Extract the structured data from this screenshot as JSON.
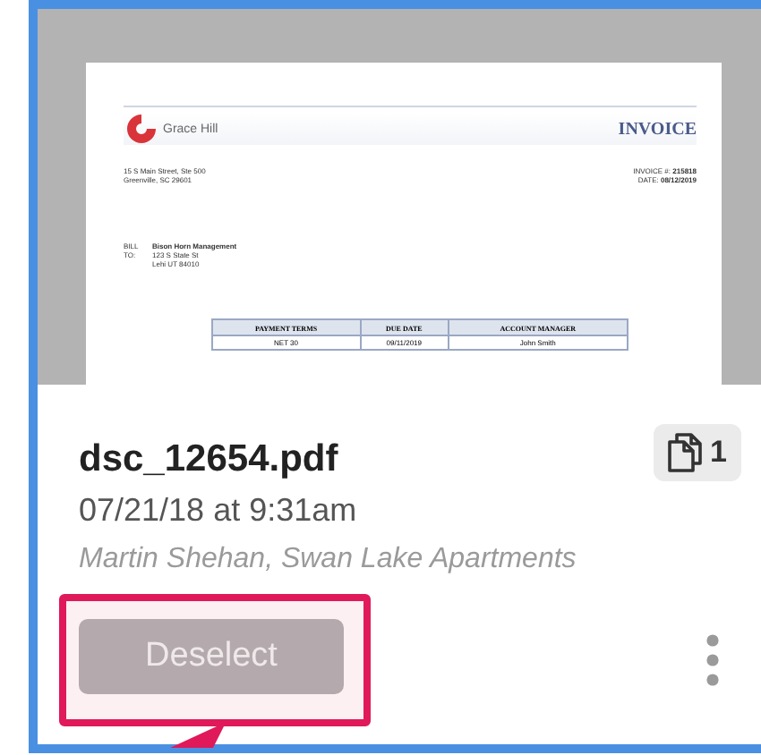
{
  "document_preview": {
    "company": "Grace Hill",
    "title": "INVOICE",
    "address_lines": [
      "15 S Main Street, Ste 500",
      "Greenville, SC 29601"
    ],
    "invoice_number_label": "INVOICE #:",
    "invoice_number": "215818",
    "date_label": "DATE:",
    "date": "08/12/2019",
    "bill_to_label": "BILL TO:",
    "bill_to_lines": [
      "Bison Horn Management",
      "123 S State St",
      "Lehi UT 84010"
    ],
    "table": {
      "columns": [
        "PAYMENT TERMS",
        "DUE DATE",
        "ACCOUNT MANAGER"
      ],
      "rows": [
        [
          "NET 30",
          "09/11/2019",
          "John Smith"
        ]
      ]
    }
  },
  "file": {
    "name": "dsc_12654.pdf",
    "page_count": "1",
    "timestamp": "07/21/18 at 9:31am",
    "uploader": "Martin Shehan, Swan Lake Apartments"
  },
  "action_button": {
    "label": "Deselect",
    "highlighted": true
  }
}
